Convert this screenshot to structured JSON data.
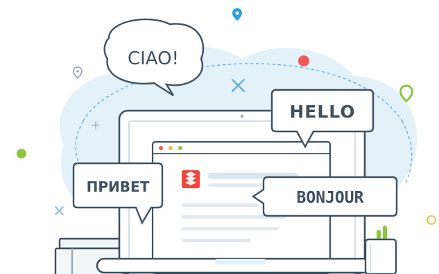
{
  "illustration": {
    "bubbles": {
      "ciao": "CIAO!",
      "hello": "HELLO",
      "privet": "ПРИВЕТ",
      "bonjour": "BONJOUR"
    },
    "colors": {
      "outline": "#3e5061",
      "cloud": "#e4f1f8",
      "accent_red": "#f25a5a",
      "accent_blue": "#2c9fe0",
      "accent_green": "#8cc63f",
      "accent_orange": "#f5b93a",
      "logo_red": "#f0463c"
    },
    "icons": [
      "map-pin-icon",
      "close-icon",
      "plus-icon",
      "browser-logo-icon",
      "pencil-cup-icon",
      "books-icon"
    ]
  }
}
